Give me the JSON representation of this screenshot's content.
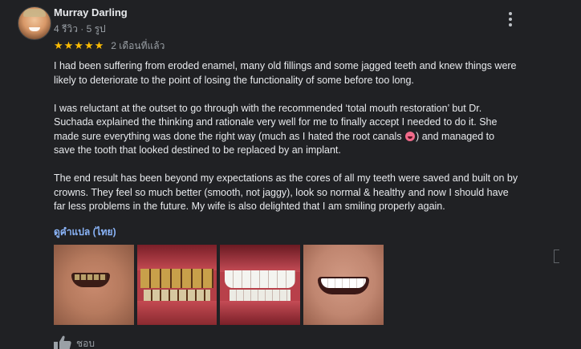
{
  "reviewer": {
    "name": "Murray Darling",
    "meta": "4 รีวิว · 5 รูป"
  },
  "rating": {
    "stars": 5,
    "stars_text": "★★★★★",
    "date": "2 เดือนที่แล้ว",
    "color": "#fbbc04"
  },
  "review": {
    "paragraph_1": "I had been suffering from eroded enamel, many old fillings and some jagged teeth and knew things were\nlikely to deteriorate to the point of losing the functionality of some before too long.",
    "paragraph_2_part_1": "I was reluctant at the outset to go through with the recommended ‘total mouth restoration’ but Dr.\nSuchada explained the thinking and rationale very well for me to finally accept I needed to do it. She\nmade sure everything was done the right way (much as I hated the root canals",
    "paragraph_2_emoji": "grinning-face-emoji",
    "paragraph_2_part_2": ") and managed to\nsave the tooth that looked destined to be replaced by an implant.",
    "paragraph_3": "The end result has been beyond my expectations as the cores of all my teeth were saved and built on by\ncrowns. They feel so much better (smooth, not jaggy), look so normal & healthy and now I should have\nfar less problems in the future. My wife is also delighted that I am smiling properly again."
  },
  "translate_link": "ดูคำแปล (ไทย)",
  "photos": [
    {
      "name": "photo-before-smile"
    },
    {
      "name": "photo-before-teeth-closeup"
    },
    {
      "name": "photo-after-teeth-closeup"
    },
    {
      "name": "photo-after-smile"
    }
  ],
  "actions": {
    "like_label": "ชอบ",
    "like_icon": "thumbs-up-icon",
    "more_icon": "more-vert-icon"
  },
  "colors": {
    "background": "#202124",
    "text": "#e8eaed",
    "secondary_text": "#9aa0a6",
    "link": "#8ab4f8"
  }
}
